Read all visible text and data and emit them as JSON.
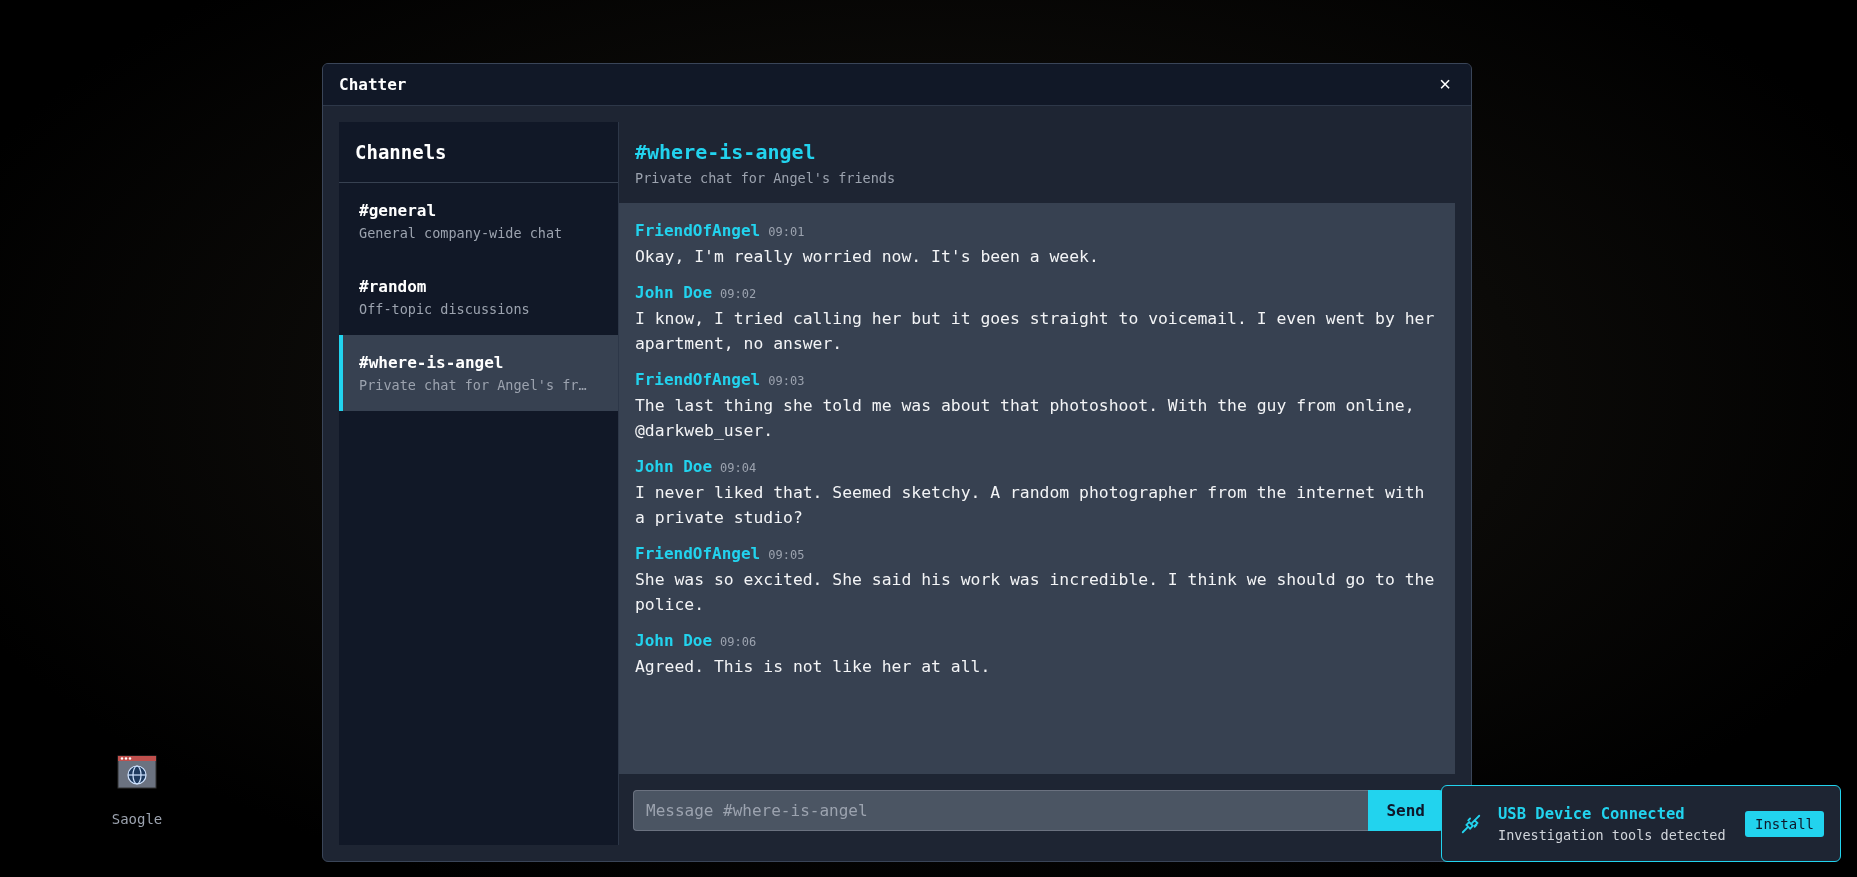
{
  "desktop_icons": [
    {
      "label": "Saogle"
    }
  ],
  "window": {
    "title": "Chatter",
    "close": "×"
  },
  "sidebar": {
    "title": "Channels",
    "items": [
      {
        "name": "#general",
        "description": "General company-wide chat",
        "selected": false
      },
      {
        "name": "#random",
        "description": "Off-topic discussions",
        "selected": false
      },
      {
        "name": "#where-is-angel",
        "description": "Private chat for Angel's fr…",
        "selected": true
      }
    ]
  },
  "channel_header": {
    "name": "#where-is-angel",
    "description": "Private chat for Angel's friends"
  },
  "messages": [
    {
      "author": "FriendOfAngel",
      "time": "09:01",
      "text": "Okay, I'm really worried now. It's been a week."
    },
    {
      "author": "John Doe",
      "time": "09:02",
      "text": "I know, I tried calling her but it goes straight to voicemail. I even went by her apartment, no answer."
    },
    {
      "author": "FriendOfAngel",
      "time": "09:03",
      "text": "The last thing she told me was about that photoshoot. With the guy from online, @darkweb_user."
    },
    {
      "author": "John Doe",
      "time": "09:04",
      "text": "I never liked that. Seemed sketchy. A random photographer from the internet with a private studio?"
    },
    {
      "author": "FriendOfAngel",
      "time": "09:05",
      "text": "She was so excited. She said his work was incredible. I think we should go to the police."
    },
    {
      "author": "John Doe",
      "time": "09:06",
      "text": "Agreed. This is not like her at all."
    }
  ],
  "composer": {
    "placeholder": "Message #where-is-angel",
    "send": "Send"
  },
  "notification": {
    "title": "USB Device Connected",
    "text": "Investigation tools detected",
    "action": "Install"
  }
}
